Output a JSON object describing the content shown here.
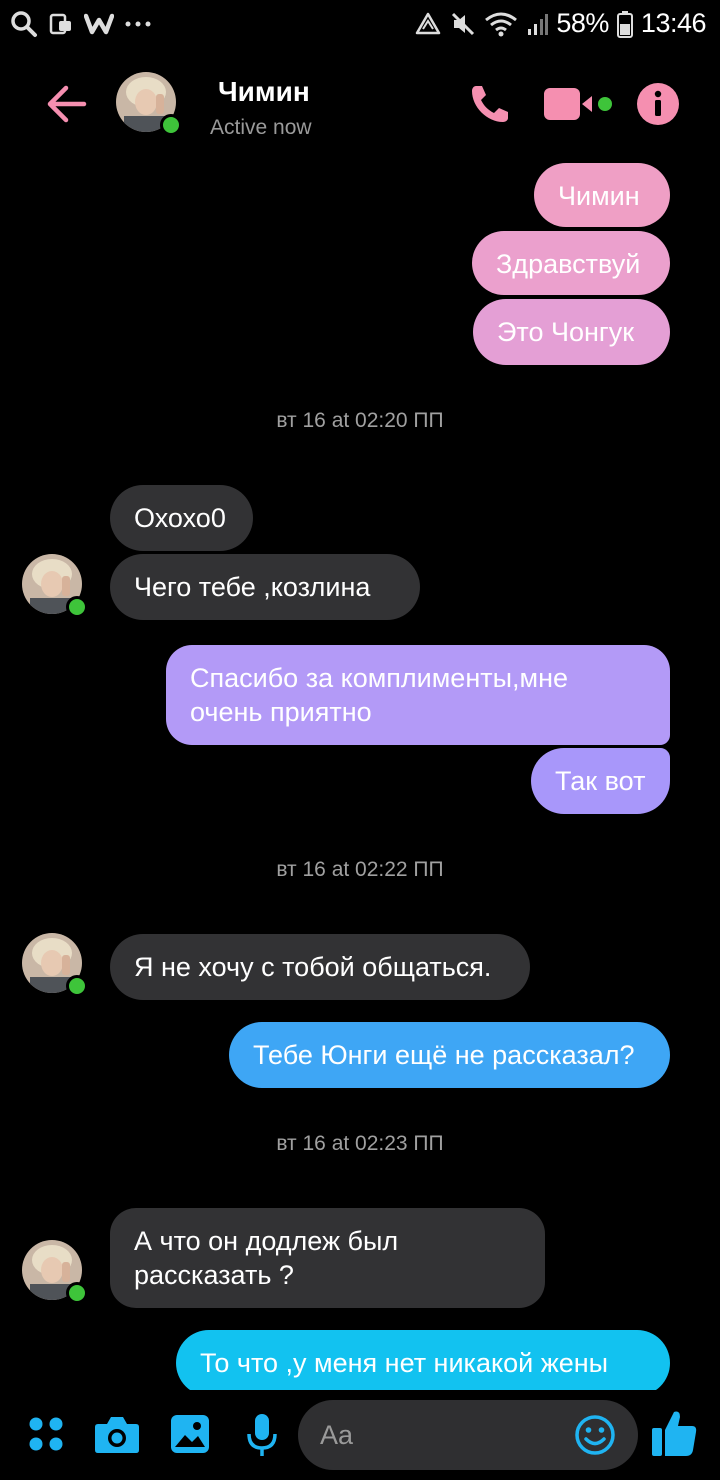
{
  "status_bar": {
    "battery": "58%",
    "time": "13:46"
  },
  "header": {
    "name": "Чимин",
    "status": "Active now"
  },
  "messages": [
    {
      "from": "me",
      "text": "Чимин"
    },
    {
      "from": "me",
      "text": "Здравствуй"
    },
    {
      "from": "me",
      "text": "Это Чонгук"
    },
    {
      "type": "timestamp",
      "text": "вт 16 at 02:20 ПП"
    },
    {
      "from": "them",
      "text": "Охохо0"
    },
    {
      "from": "them",
      "text": "Чего тебе ,козлина"
    },
    {
      "from": "me",
      "text": "Спасибо за комплименты,мне\nочень приятно"
    },
    {
      "from": "me",
      "text": "Так вот"
    },
    {
      "type": "timestamp",
      "text": "вт 16 at 02:22 ПП"
    },
    {
      "from": "them",
      "text": "Я не хочу с тобой общаться."
    },
    {
      "from": "me",
      "text": "Тебе Юнги ещё не рассказал?"
    },
    {
      "type": "timestamp",
      "text": "вт 16 at 02:23 ПП"
    },
    {
      "from": "them",
      "text": "А что он додлеж был\nрассказать ?"
    },
    {
      "from": "me",
      "text": "То что ,у меня нет никакой жены"
    }
  ],
  "composer": {
    "placeholder": "Aa"
  },
  "colors": {
    "accent_pink": "#f58fb0",
    "me_gradient_pink": "#ef9fc5",
    "me_gradient_purple": "#a890fa",
    "me_gradient_blue": "#12c2f0",
    "bottom_icons": "#1fb4f2",
    "online_dot": "#3ec43a",
    "incoming_bubble": "#323234"
  }
}
